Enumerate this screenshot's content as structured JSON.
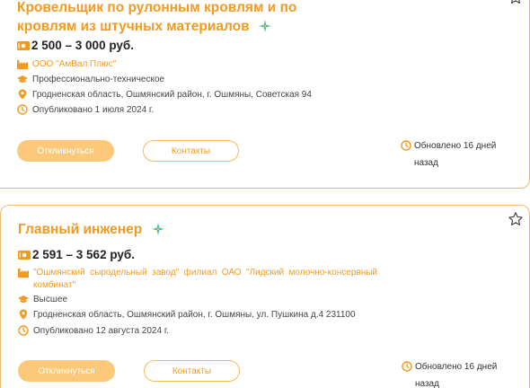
{
  "colors": {
    "accent": "#f29a1f",
    "button_fill": "#fcc97b",
    "border": "#f2b96a",
    "spark": "#2bb3c8"
  },
  "vacancies": [
    {
      "title": "Кровельщик по рулонным кровлям и по кровлям из штучных материалов",
      "salary": "2 500 – 3 000 руб.",
      "company": "ООО \"АмВал Плюс\"",
      "education": "Профессионально-техническое",
      "address": "Гродненская область, Ошмянский район, г. Ошмяны, Советская 94",
      "published": "Опубликовано 1 июля 2024 г.",
      "apply_label": "Откликнуться",
      "contacts_label": "Контакты",
      "updated": "Обновлено 16 дней назад"
    },
    {
      "title": "Главный инженер",
      "salary": "2 591 – 3 562 руб.",
      "company": "\"Ошмянский сыродельный завод\" филиал ОАО \"Лидский молочно-консервный комбинат\"",
      "education": "Высшее",
      "address": "Гродненская область, Ошмянский район, г. Ошмяны, ул. Пушкина д.4 231100",
      "published": "Опубликовано 12 августа 2024 г.",
      "apply_label": "Откликнуться",
      "contacts_label": "Контакты",
      "updated": "Обновлено 16 дней назад"
    }
  ],
  "icons": {
    "salary": "money-icon",
    "company": "factory-icon",
    "education": "graduation-cap-icon",
    "address": "location-pin-icon",
    "published": "clock-icon",
    "favorite": "star-icon",
    "highlight": "sparkle-icon"
  }
}
